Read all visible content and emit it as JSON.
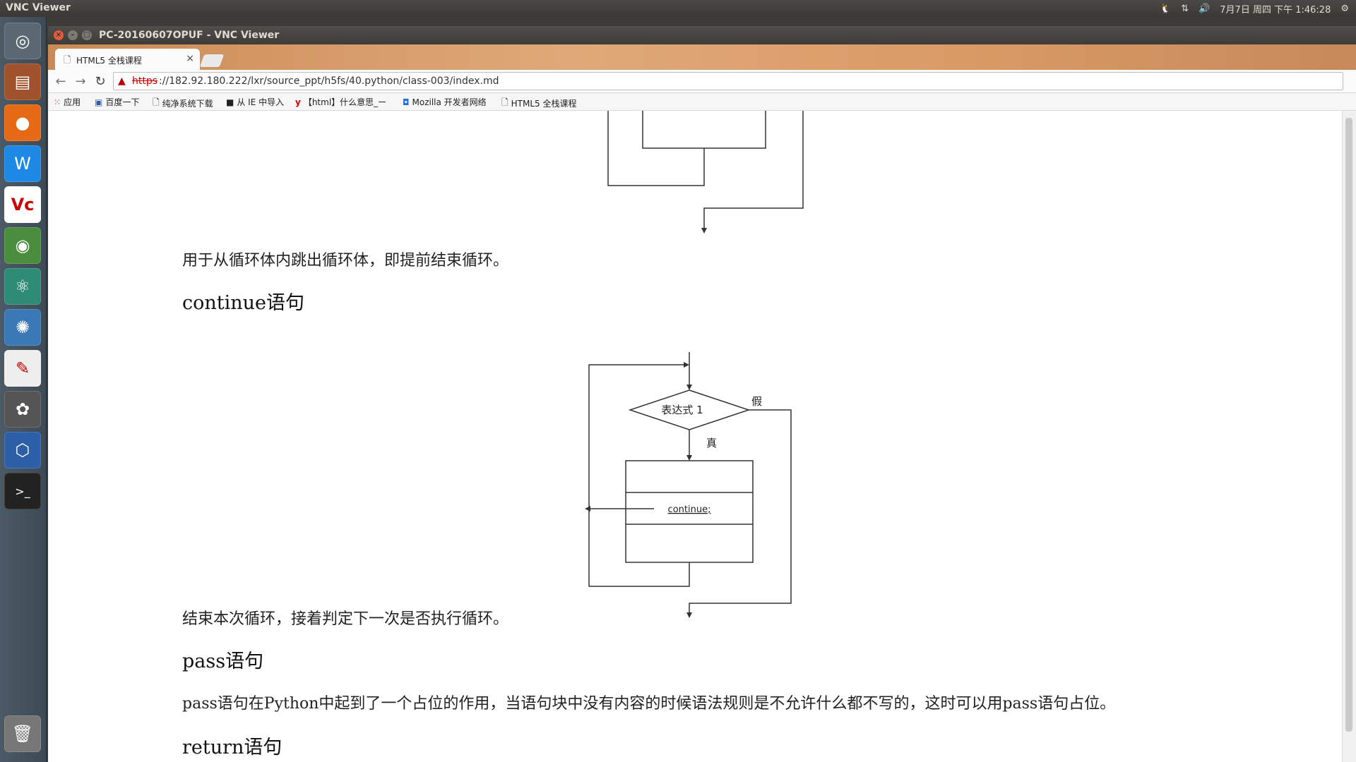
{
  "top_panel": {
    "app_title": "VNC Viewer",
    "clock": "7月7日 周四 下午 1:46:28"
  },
  "window": {
    "title": "PC-20160607OPUF - VNC Viewer"
  },
  "browser": {
    "tab_title": "HTML5 全栈课程",
    "url_scheme": "https",
    "url_rest": "://182.92.180.222/lxr/source_ppt/h5fs/40.python/class-003/index.md",
    "bookmarks": [
      "应用",
      "百度一下",
      "纯净系统下载",
      "从 IE 中导入",
      "【html】什么意思_ー",
      "Mozilla 开发者网络",
      "HTML5 全栈课程"
    ]
  },
  "document": {
    "break_desc": "用于从循环体内跳出循环体，即提前结束循环。",
    "continue_heading": "continue语句",
    "continue_diagram": {
      "condition": "表达式 1",
      "false_label": "假",
      "true_label": "真",
      "statement": "continue;"
    },
    "continue_desc": "结束本次循环，接着判定下一次是否执行循环。",
    "pass_heading": "pass语句",
    "pass_desc": "pass语句在Python中起到了一个占位的作用，当语句块中没有内容的时候语法规则是不允许什么都不写的，这时可以用pass语句占位。",
    "return_heading": "return语句"
  },
  "colors": {
    "panel_bg": "#3c3b37",
    "tab_strip": "#d99a66",
    "warning_red": "#cc0000"
  }
}
